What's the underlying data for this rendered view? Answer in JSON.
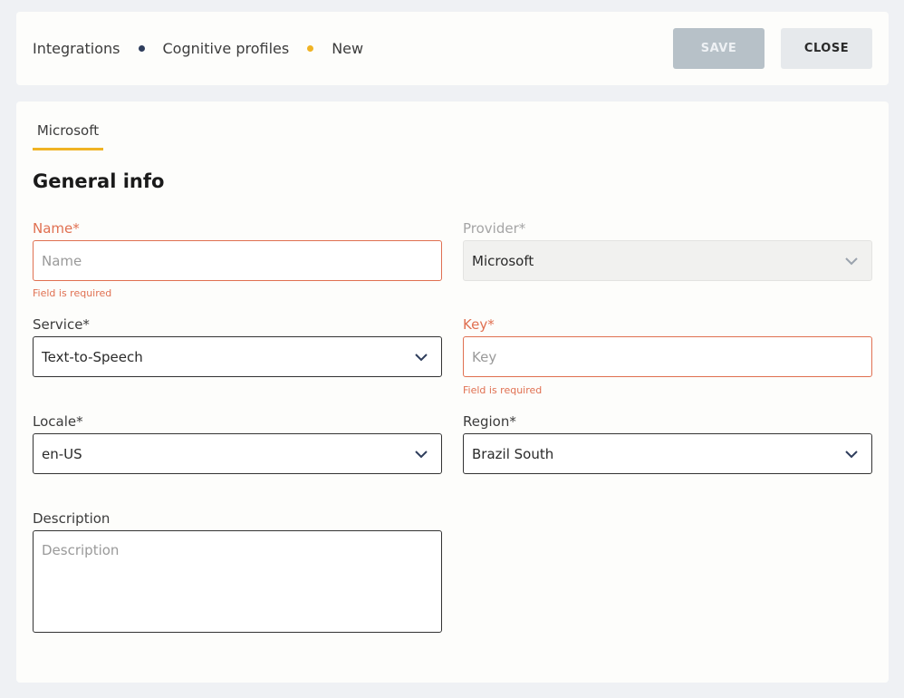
{
  "breadcrumb": {
    "items": [
      "Integrations",
      "Cognitive profiles",
      "New"
    ],
    "dot_colors": [
      "#2e3d5c",
      "#f0b324"
    ]
  },
  "toolbar": {
    "save_label": "SAVE",
    "close_label": "CLOSE"
  },
  "tabs": [
    {
      "label": "Microsoft",
      "active": true
    }
  ],
  "section": {
    "title": "General info"
  },
  "form": {
    "name": {
      "label": "Name*",
      "placeholder": "Name",
      "error": "Field is required"
    },
    "provider": {
      "label": "Provider*",
      "value": "Microsoft"
    },
    "service": {
      "label": "Service*",
      "value": "Text-to-Speech"
    },
    "key": {
      "label": "Key*",
      "placeholder": "Key",
      "error": "Field is required"
    },
    "locale": {
      "label": "Locale*",
      "value": "en-US"
    },
    "region": {
      "label": "Region*",
      "value": "Brazil South"
    },
    "description": {
      "label": "Description",
      "placeholder": "Description"
    }
  },
  "colors": {
    "accent": "#f0b324",
    "error": "#e07051",
    "save_disabled": "#b7c1c8"
  }
}
